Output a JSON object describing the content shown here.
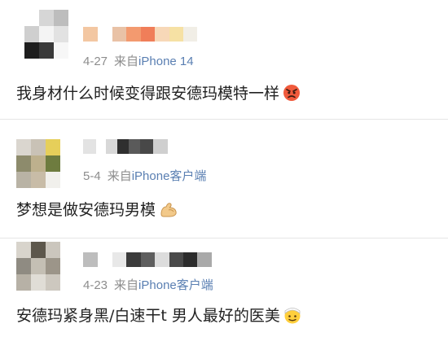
{
  "comments": [
    {
      "date": "4-27",
      "from_prefix": "来自",
      "source": "iPhone 14",
      "text": "我身材什么时候变得跟安德玛模特一样",
      "emoji_icon": "angry-face-emoji"
    },
    {
      "date": "5-4",
      "from_prefix": "来自",
      "source": "iPhone客户端",
      "text": "梦想是做安德玛男模",
      "emoji_icon": "flexed-biceps-emoji"
    },
    {
      "date": "4-23",
      "from_prefix": "来自",
      "source": "iPhone客户端",
      "text": "安德玛紧身黑/白速干t 男人最好的医美",
      "emoji_icon": "face-with-head-bandage-emoji"
    }
  ],
  "colors": {
    "meta_text": "#8d8d8d",
    "source_link": "#5a7fb2",
    "body_text": "#222222",
    "divider": "#e6e6e6"
  }
}
